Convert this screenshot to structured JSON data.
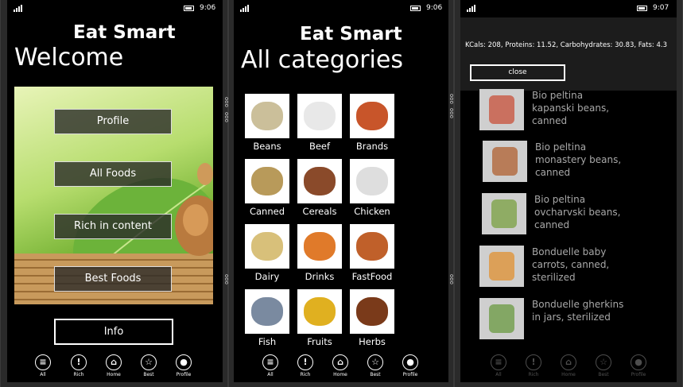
{
  "screens": {
    "welcome": {
      "clock": "9:06",
      "app_title": "Eat Smart",
      "page_title": "Welcome",
      "buttons": {
        "profile": "Profile",
        "all_foods": "All Foods",
        "rich": "Rich in content",
        "best": "Best Foods"
      },
      "info": "Info",
      "scroll_marks": {
        "top": "ooo",
        "mid": "ooo",
        "bottom": "ooo"
      }
    },
    "categories": {
      "clock": "9:06",
      "app_title": "Eat Smart",
      "page_title": "All categories",
      "items": [
        "Beans",
        "Beef",
        "Brands",
        "Canned",
        "Cereals",
        "Chicken",
        "Dairy",
        "Drinks",
        "FastFood",
        "Fish",
        "Fruits",
        "Herbs"
      ],
      "scroll_marks": {
        "top": "ooo",
        "mid": "ooo",
        "bottom": "ooo"
      }
    },
    "detail": {
      "clock": "9:07",
      "nutrition": "KCals: 208, Proteins: 11.52, Carbohydrates: 30.83, Fats: 4.3",
      "close": "close",
      "products": [
        "Bio peltina kapanski beans, canned",
        "Bio peltina monastery beans, canned",
        "Bio peltina ovcharvski beans, canned",
        "Bonduelle baby carrots, canned, sterilized",
        "Bonduelle gherkins in jars, sterilized"
      ]
    }
  },
  "bottom_bar": {
    "all": "All",
    "rich": "Rich",
    "home": "Home",
    "best": "Best",
    "profile": "Profile"
  },
  "icons": {
    "all": "list-icon",
    "rich": "exclamation-icon",
    "home": "home-icon",
    "best": "star-icon",
    "profile": "person-icon"
  }
}
